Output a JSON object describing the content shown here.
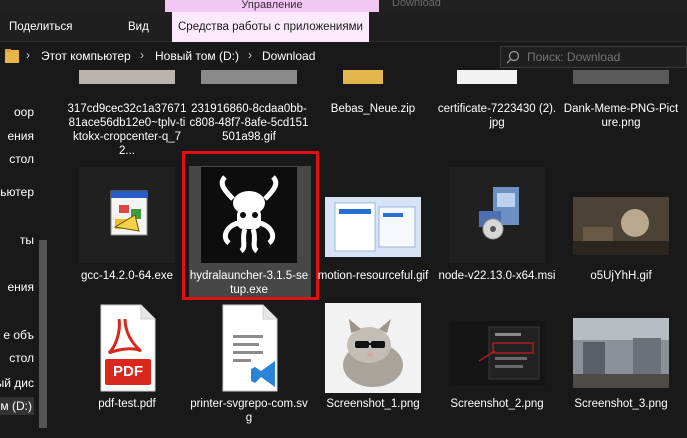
{
  "context_tab": {
    "label": "Управление",
    "window_title": "Download"
  },
  "ribbon": {
    "tabs": [
      "Поделиться",
      "Вид",
      "Средства работы с приложениями"
    ]
  },
  "address": {
    "crumbs": [
      "Этот компьютер",
      "Новый том (D:)",
      "Download"
    ],
    "search_placeholder": "Поиск: Download"
  },
  "nav": {
    "items": [
      {
        "label": "оор"
      },
      {
        "label": "ения"
      },
      {
        "label": "стол"
      },
      {
        "label": "ьютер"
      },
      {
        "label": "ты"
      },
      {
        "label": "ения"
      },
      {
        "label": "е объ"
      },
      {
        "label": "стол"
      },
      {
        "label": "ый дис"
      },
      {
        "label": "ом (D:)",
        "selected": true
      }
    ]
  },
  "files": {
    "row1": [
      {
        "name": "317cd9cec32c1a3767181ace56db12e0~tplv-tiktokx-cropcenter-q_72...",
        "icon": "image-thumbnail"
      },
      {
        "name": "231916860-8cdaa0bb-c808-48f7-8afe-5cd151501a98.gif",
        "icon": "image-thumbnail"
      },
      {
        "name": "Bebas_Neue.zip",
        "icon": "zip-folder-icon"
      },
      {
        "name": "certificate-7223430 (2).jpg",
        "icon": "image-thumbnail"
      },
      {
        "name": "Dank-Meme-PNG-Picture.png",
        "icon": "image-thumbnail"
      }
    ],
    "row2": [
      {
        "name": "gcc-14.2.0-64.exe",
        "icon": "installer-icon"
      },
      {
        "name": "hydralauncher-3.1.5-setup.exe",
        "icon": "hydra-logo-icon",
        "selected": true
      },
      {
        "name": "motion-resourceful.gif",
        "icon": "image-thumbnail"
      },
      {
        "name": "node-v22.13.0-x64.msi",
        "icon": "msi-installer-icon"
      },
      {
        "name": "o5UjYhH.gif",
        "icon": "image-thumbnail"
      }
    ],
    "row3": [
      {
        "name": "pdf-test.pdf",
        "icon": "pdf-icon",
        "badge": "PDF"
      },
      {
        "name": "printer-svgrepo-com.svg",
        "icon": "svg-file-icon"
      },
      {
        "name": "Screenshot_1.png",
        "icon": "kitten-thumbnail"
      },
      {
        "name": "Screenshot_2.png",
        "icon": "image-thumbnail"
      },
      {
        "name": "Screenshot_3.png",
        "icon": "image-thumbnail"
      }
    ]
  },
  "colors": {
    "background": "#191919",
    "selection": "#474747",
    "highlight_border": "#e21111",
    "context_tab": "#f1c8f3"
  }
}
